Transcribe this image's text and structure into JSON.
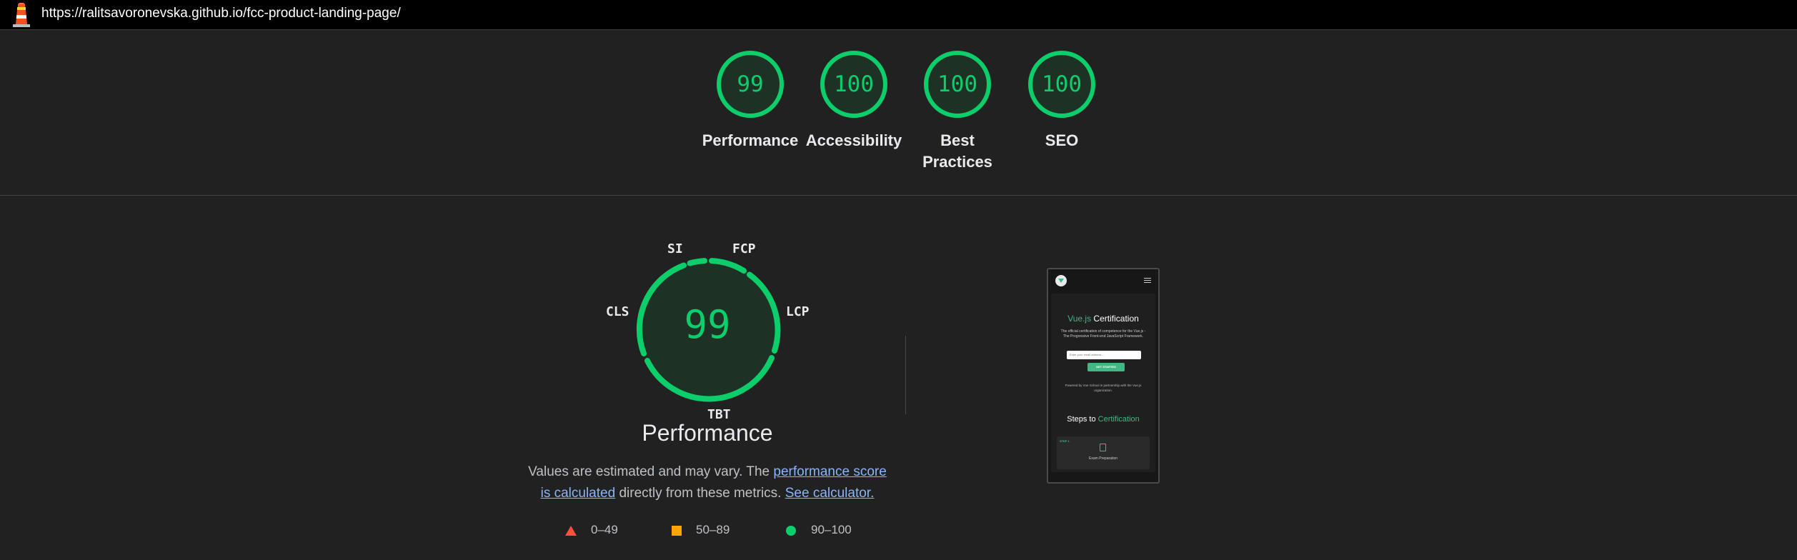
{
  "url_bar": {
    "icon": "lighthouse-icon",
    "url": "https://ralitsavoronevska.github.io/fcc-product-landing-page/"
  },
  "summary": {
    "gauges": [
      {
        "score": "99",
        "label": "Performance",
        "value": 99
      },
      {
        "score": "100",
        "label": "Accessibility",
        "value": 100
      },
      {
        "score": "100",
        "label_line1": "Best",
        "label_line2": "Practices",
        "value": 100
      },
      {
        "score": "100",
        "label": "SEO",
        "value": 100
      }
    ]
  },
  "performance": {
    "score": "99",
    "title": "Performance",
    "metrics": {
      "si": "SI",
      "fcp": "FCP",
      "cls": "CLS",
      "lcp": "LCP",
      "tbt": "TBT"
    },
    "description_prefix": "Values are estimated and may vary. The ",
    "description_link1": "performance score is calculated",
    "description_middle": " directly from these metrics. ",
    "description_link2": "See calculator."
  },
  "legend": {
    "fail": "0–49",
    "average": "50–89",
    "pass": "90–100"
  },
  "colors": {
    "pass": "#0cce6b",
    "average": "#ffa400",
    "fail": "#ff4e42",
    "link": "#8ab4f8",
    "background": "#212121"
  },
  "thumbnail": {
    "title_brand": "Vue.js",
    "title_rest": " Certification",
    "description": "The official certification of competence for the Vue.js - The Progressive Front-end JavaScript Framework.",
    "input_placeholder": "Enter your email address...",
    "button": "GET STARTED",
    "powered_by": "Powered by Vue School in partnership with the Vue.js organization.",
    "steps_prefix": "Steps to ",
    "steps_highlight": "Certification",
    "step_label": "STEP 1",
    "step_title": "Exam Preparation"
  }
}
